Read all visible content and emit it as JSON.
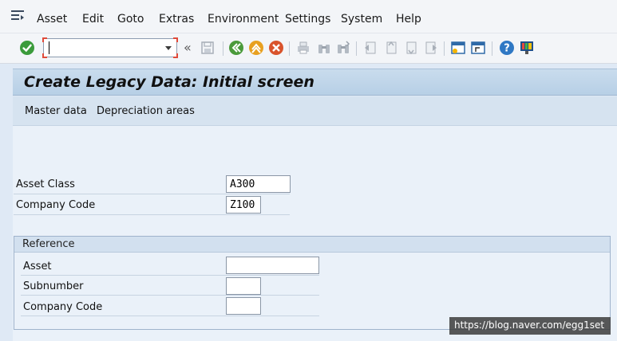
{
  "menu": {
    "items": [
      {
        "label": "Asset"
      },
      {
        "label": "Edit"
      },
      {
        "label": "Goto"
      },
      {
        "label": "Extras"
      },
      {
        "label": "Environment"
      },
      {
        "label": "Settings"
      },
      {
        "label": "System"
      },
      {
        "label": "Help"
      }
    ]
  },
  "toolbar": {
    "command_value": "",
    "collapse_glyph": "«"
  },
  "title": "Create Legacy Data: Initial screen",
  "app_toolbar": {
    "master_data": "Master data",
    "depreciation_areas": "Depreciation areas"
  },
  "form": {
    "asset_class_label": "Asset Class",
    "asset_class_value": "A300",
    "company_code_label": "Company Code",
    "company_code_value": "Z100"
  },
  "reference": {
    "title": "Reference",
    "asset_label": "Asset",
    "asset_value": "",
    "subnumber_label": "Subnumber",
    "subnumber_value": "",
    "company_code_label": "Company Code",
    "company_code_value": ""
  },
  "watermark": "https://blog.naver.com/egg1set",
  "colors": {
    "title_bar": "#c9dced",
    "content_bg": "#eaf1f9",
    "accent_red": "#e04a3a"
  }
}
